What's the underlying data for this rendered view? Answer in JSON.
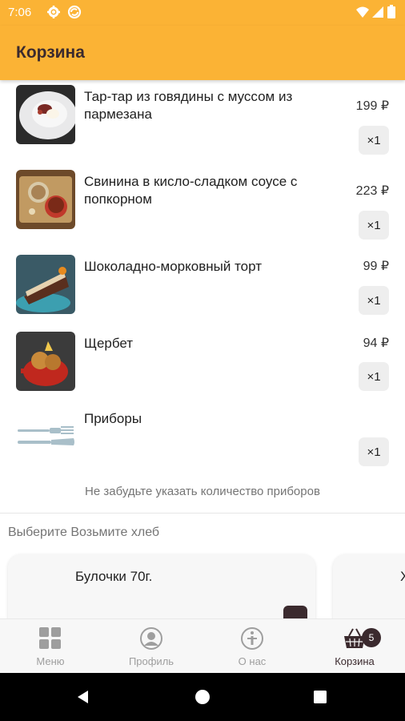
{
  "status_bar": {
    "time": "7:06"
  },
  "app_bar": {
    "title": "Корзина"
  },
  "cart_items": [
    {
      "name": "Тар-тар из говядины с муссом из пармезана",
      "price": "199 ₽",
      "qty": "×1"
    },
    {
      "name": "Свинина в кисло-сладком соусе с попкорном",
      "price": "223 ₽",
      "qty": "×1"
    },
    {
      "name": "Шоколадно-морковный торт",
      "price": "99 ₽",
      "qty": "×1"
    },
    {
      "name": "Щербет",
      "price": "94 ₽",
      "qty": "×1"
    },
    {
      "name": "Приборы",
      "price": "",
      "qty": "×1"
    }
  ],
  "hint": "Не забудьте указать количество приборов",
  "bread_section": {
    "title": "Выберите Возьмите хлеб",
    "items": [
      {
        "name": "Булочки 70г."
      },
      {
        "name": "Х"
      }
    ]
  },
  "bottom_nav": {
    "items": [
      {
        "label": "Меню",
        "icon": "grid-icon"
      },
      {
        "label": "Профиль",
        "icon": "profile-icon"
      },
      {
        "label": "О нас",
        "icon": "info-icon"
      },
      {
        "label": "Корзина",
        "icon": "basket-icon",
        "badge": "5",
        "active": true
      }
    ]
  },
  "colors": {
    "accent": "#fbb335",
    "brand": "#3b2a2e",
    "muted": "#9e9e9e"
  }
}
